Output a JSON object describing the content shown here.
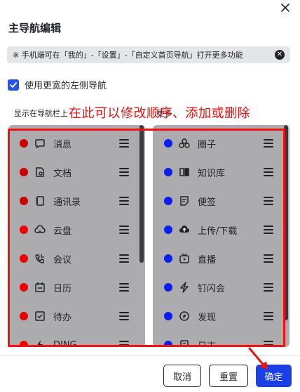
{
  "dialog": {
    "title": "主导航编辑",
    "tip": "※ 手机端可在「我的」-「设置」-「自定义首页导航」打开更多功能",
    "checkbox_label": "使用更宽的左侧导航",
    "checkbox_checked": true,
    "left_section_label": "显示在导航栏上",
    "right_section_label": "更多",
    "annotation": "在此可以修改顺序、添加或删除"
  },
  "left_items": [
    {
      "label": "消息",
      "icon": "chat-bubble-icon",
      "dot_color": "#cc0000"
    },
    {
      "label": "文档",
      "icon": "document-icon",
      "dot_color": "#cc0000"
    },
    {
      "label": "通讯录",
      "icon": "contacts-icon",
      "dot_color": "#cc0000"
    },
    {
      "label": "云盘",
      "icon": "cloud-drive-icon",
      "dot_color": "#ee0000"
    },
    {
      "label": "会议",
      "icon": "phone-meeting-icon",
      "dot_color": "#ee0000"
    },
    {
      "label": "日历",
      "icon": "calendar-icon",
      "dot_color": "#ee0000"
    },
    {
      "label": "待办",
      "icon": "todo-icon",
      "dot_color": "#ee0000"
    },
    {
      "label": "DING",
      "icon": "ding-icon",
      "dot_color": "#ee0000"
    }
  ],
  "right_items": [
    {
      "label": "圈子",
      "icon": "circle-group-icon",
      "dot_color": "#0a1ef0"
    },
    {
      "label": "知识库",
      "icon": "knowledge-base-icon",
      "dot_color": "#0a1ef0"
    },
    {
      "label": "便签",
      "icon": "sticky-note-icon",
      "dot_color": "#0a1ef0"
    },
    {
      "label": "上传/下载",
      "icon": "upload-download-icon",
      "dot_color": "#0a1ef0"
    },
    {
      "label": "直播",
      "icon": "live-tv-icon",
      "dot_color": "#0a1ef0"
    },
    {
      "label": "钉闪会",
      "icon": "flash-meeting-icon",
      "dot_color": "#0a1ef0"
    },
    {
      "label": "发现",
      "icon": "compass-icon",
      "dot_color": "#0a1ef0"
    },
    {
      "label": "日志",
      "icon": "log-icon",
      "dot_color": "#0a1ef0"
    }
  ],
  "footer": {
    "cancel_label": "取消",
    "reset_label": "重置",
    "ok_label": "确定"
  },
  "colors": {
    "accent_blue": "#1b3fe6",
    "annotation_red": "#ee1111",
    "panel_gray": "#acacaf"
  }
}
